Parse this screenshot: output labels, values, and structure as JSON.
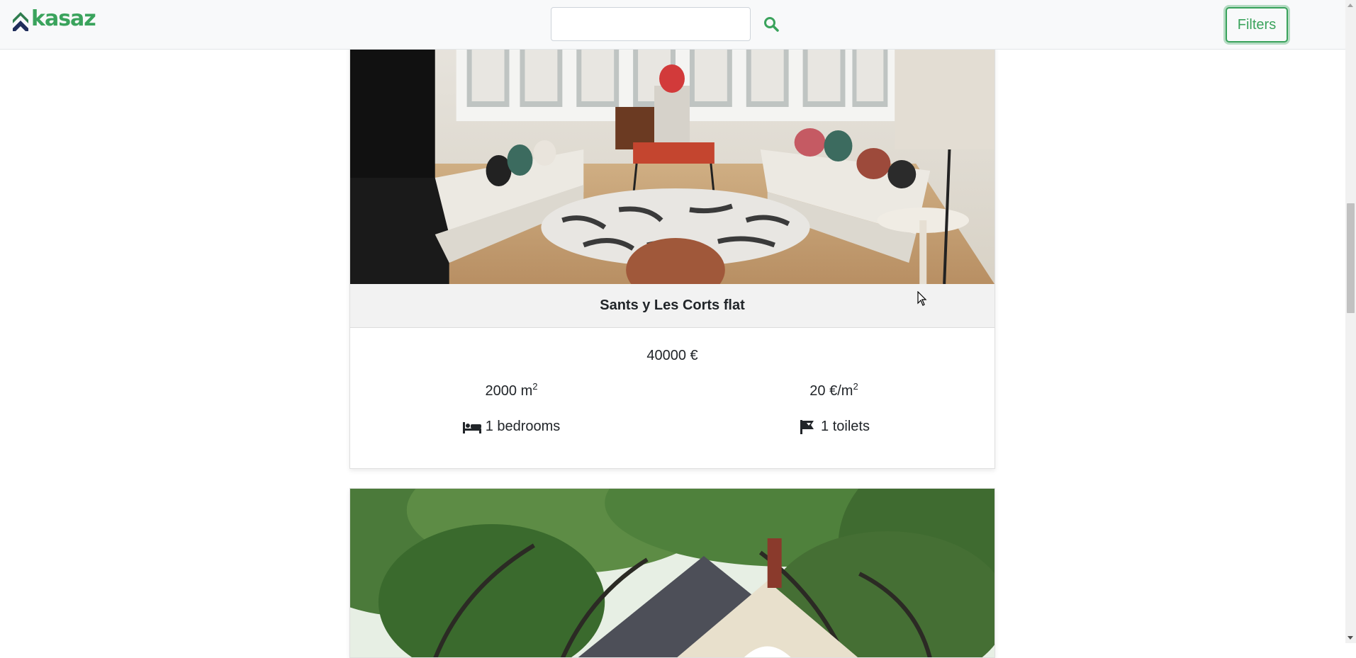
{
  "navbar": {
    "brand_name": "kasaz",
    "search_placeholder": "",
    "search_value": "",
    "search_icon": "search-icon",
    "filters_label": "Filters",
    "accent_color": "#3aa35c"
  },
  "listings": [
    {
      "title": "Sants y Les Corts flat",
      "price": "40000 €",
      "area_value": "2000 m",
      "area_unit_exp": "2",
      "price_per_m2": "20 €/m",
      "price_per_m2_exp": "2",
      "bedrooms": "1 bedrooms",
      "bedrooms_icon": "bed-icon",
      "toilets": "1 toilets",
      "toilets_icon": "toilet-icon",
      "image": "living-room-photo"
    },
    {
      "image": "house-under-trees-photo"
    }
  ]
}
